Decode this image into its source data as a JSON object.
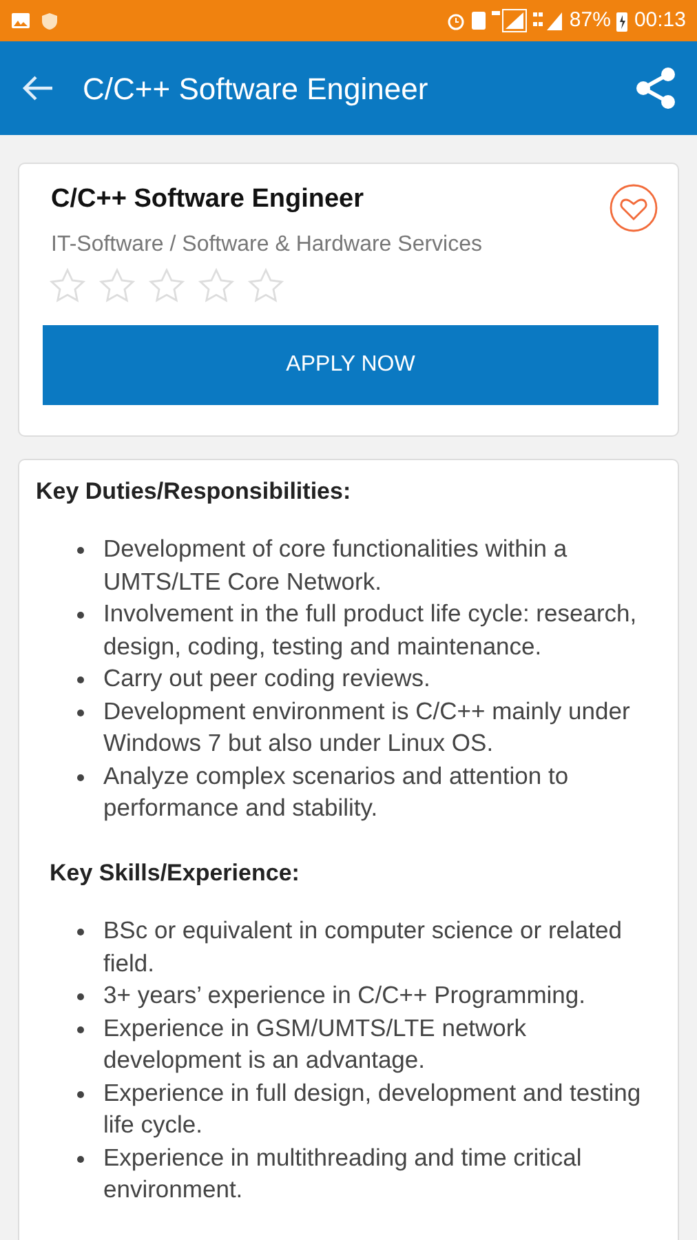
{
  "status_bar": {
    "battery": "87%",
    "time": "00:13"
  },
  "app_bar": {
    "title": "C/C++ Software Engineer"
  },
  "job": {
    "title": "C/C++ Software Engineer",
    "category": "IT-Software / Software & Hardware Services",
    "stars": 0,
    "favorite": false,
    "apply_button": "APPLY NOW"
  },
  "sections": [
    {
      "heading": "Key Duties/Responsibilities:",
      "items": [
        "Development of core functionalities within a UMTS/LTE Core Network.",
        "Involvement in the full product life cycle: research, design, coding, testing and maintenance.",
        "Carry out peer coding reviews.",
        "Development environment is C/C++ mainly under Windows 7 but also under Linux OS.",
        "Analyze complex scenarios and attention to performance and stability."
      ]
    },
    {
      "heading": "Key Skills/Experience:",
      "items": [
        "BSc or equivalent in computer science or related field.",
        "3+ years’ experience in C/C++ Programming.",
        "Experience in GSM/UMTS/LTE network development is an advantage.",
        "Experience in full design, development and testing life cycle.",
        "Experience in multithreading and time critical environment."
      ]
    }
  ]
}
